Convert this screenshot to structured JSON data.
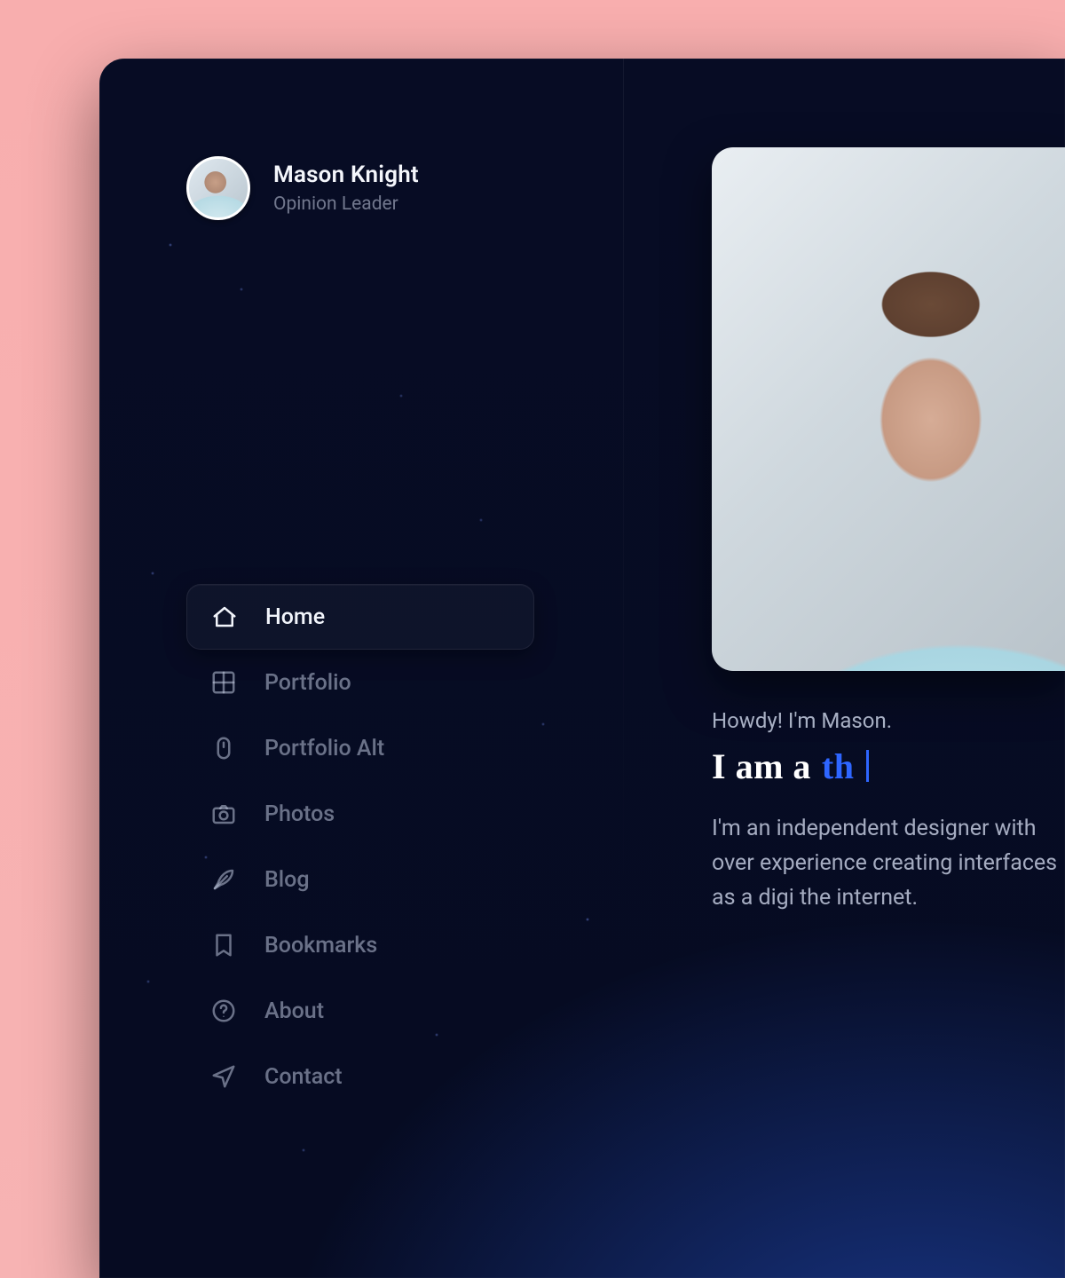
{
  "profile": {
    "name": "Mason Knight",
    "subtitle": "Opinion Leader"
  },
  "nav": {
    "items": [
      {
        "label": "Home",
        "icon": "home-icon",
        "active": true
      },
      {
        "label": "Portfolio",
        "icon": "grid-icon",
        "active": false
      },
      {
        "label": "Portfolio Alt",
        "icon": "mouse-icon",
        "active": false
      },
      {
        "label": "Photos",
        "icon": "camera-icon",
        "active": false
      },
      {
        "label": "Blog",
        "icon": "feather-icon",
        "active": false
      },
      {
        "label": "Bookmarks",
        "icon": "bookmark-icon",
        "active": false
      },
      {
        "label": "About",
        "icon": "help-icon",
        "active": false
      },
      {
        "label": "Contact",
        "icon": "send-icon",
        "active": false
      }
    ]
  },
  "main": {
    "greeting": "Howdy! I'm Mason.",
    "headline_prefix": "I am a",
    "headline_typed": "th",
    "body": "I'm an independent designer with over experience creating interfaces as a digi the internet."
  }
}
